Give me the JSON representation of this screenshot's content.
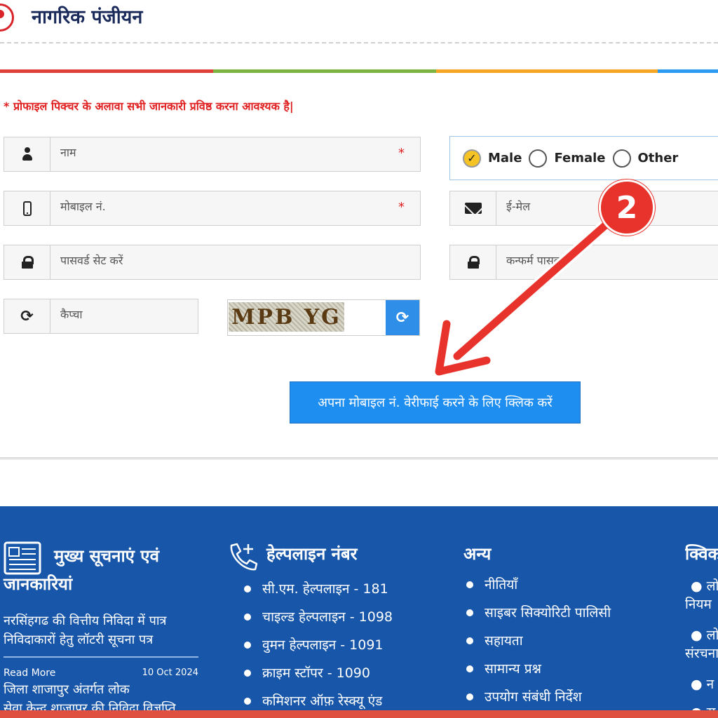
{
  "header": {
    "title": "नागरिक पंजीयन"
  },
  "colors": {
    "bar": [
      "#e0403a",
      "#7cb342",
      "#f5a623",
      "#2b9af3"
    ],
    "primary": "#1f8ef1",
    "footer": "#1756a9",
    "required": "#e02020"
  },
  "form": {
    "note": "* प्रोफाइल पिक्चर के अलावा सभी जानकारी प्रविष्ठ करना आवश्यक है|",
    "name_placeholder": "नाम",
    "mobile_placeholder": "मोबाइल नं.",
    "email_placeholder": "ई-मेल",
    "password_placeholder": "पासवर्ड सेट करें",
    "confirm_placeholder": "कन्फर्म पासवर्ड",
    "captcha_placeholder": "कैप्चा",
    "required_mark": "*",
    "gender": {
      "options": [
        "Male",
        "Female",
        "Other"
      ],
      "selected": "Male"
    },
    "captcha_text": "MPB YG",
    "verify_button": "अपना मोबाइल नं. वेरीफाई करने के लिए क्लिक करें"
  },
  "annotation": {
    "step": "2"
  },
  "footer": {
    "news": {
      "title_line1": "मुख्य सूचनाएं एवं",
      "title_line2": "जानकारियां",
      "item1_line1": "नरसिंहगढ की वित्तीय निविदा में पात्र",
      "item1_line2": "निविदाकारों हेतु लॉटरी सूचना पत्र",
      "read_more": "Read More",
      "date": "10 Oct 2024",
      "item2_line1": "जिला शाजापुर अंतर्गत लोक",
      "item2_line2": "सेवा केन्द्र शाजापुर की निविदा विज्ञप्ति"
    },
    "helpline": {
      "title": "हेल्पलाइन नंबर",
      "items": [
        "सी.एम. हेल्पलाइन - 181",
        "चाइल्ड हेल्पलाइन - 1098",
        "वुमन हेल्पलाइन - 1091",
        "क्राइम स्टॉपर - 1090",
        "कमिशनर ऑफ़ रेस्क्यू एंड"
      ]
    },
    "other": {
      "title": "अन्य",
      "items": [
        "नीतियाँ",
        "साइबर सिक्योरिटी पालिसी",
        "सहायता",
        "सामान्य प्रश्न",
        "उपयोग संबंधी निर्देश"
      ]
    },
    "quick": {
      "title": "क्विक",
      "items": [
        "लो",
        "नियम",
        "लो",
        "संरचना",
        "न",
        "स"
      ]
    }
  }
}
